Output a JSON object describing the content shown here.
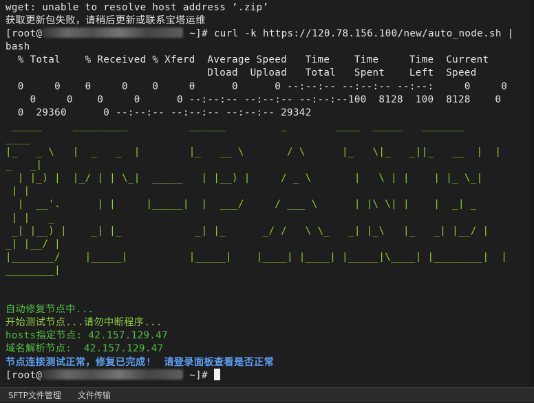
{
  "terminal": {
    "lines": [
      {
        "cls": "white",
        "text": "wget: unable to resolve host address ‘.zip’"
      },
      {
        "cls": "white",
        "text": "获取更新包失败，请稍后更新或联系宝塔运维"
      },
      {
        "cls": "white",
        "prompt_prefix": "[root@",
        "prompt_suffix": " ~]# ",
        "text": "curl -k https://120.78.156.100/new/auto_node.sh |"
      },
      {
        "cls": "white",
        "text": "bash"
      },
      {
        "cls": "white",
        "text": "  % Total    % Received % Xferd  Average Speed   Time    Time     Time  Current"
      },
      {
        "cls": "white",
        "text": "                                 Dload  Upload   Total   Spent    Left  Speed"
      },
      {
        "cls": "white",
        "text": "  0     0    0     0    0     0      0      0 --:--:-- --:--:-- --:--:     0     0    0"
      },
      {
        "cls": "white",
        "text": "    0     0    0     0      0 --:--:-- --:--:-- --:--:--100  8128  100  8128    0"
      },
      {
        "cls": "white",
        "text": "  0  29360      0 --:--:-- --:--:-- --:--:-- 29342"
      },
      {
        "cls": "ascii",
        "text": " _____     _________          ______         _        ____  _____   _______"
      },
      {
        "cls": "ascii",
        "text": "____"
      },
      {
        "cls": "ascii",
        "text": "|_   _ \\   |  _   _  |        |_   __ \\       / \\      |_   \\|_   _||_   __  |  |"
      },
      {
        "cls": "ascii",
        "text": "_   _|"
      },
      {
        "cls": "ascii",
        "text": "  | |_) |  |_/ | | \\_|  _____   | |__) |     / _ \\       |   \\ | |    | |_ \\_|"
      },
      {
        "cls": "ascii",
        "text": " | |"
      },
      {
        "cls": "ascii",
        "text": "  |  __'.      | |     |_____|  |  ___/     / ___ \\      | |\\ \\| |    |  _| _"
      },
      {
        "cls": "ascii",
        "text": " | |   _"
      },
      {
        "cls": "ascii",
        "text": " _| |__) |    _| |_            _| |_      _/ /   \\ \\_   _| |_\\   |_   _| |__/ |"
      },
      {
        "cls": "ascii",
        "text": "_| |__/ |"
      },
      {
        "cls": "ascii",
        "text": "|_______/    |_____|          |_____|    |____| |____| |_____|\\____| |________|  |"
      },
      {
        "cls": "ascii",
        "text": "________|"
      },
      {
        "cls": "white",
        "text": ""
      },
      {
        "cls": "white",
        "text": ""
      },
      {
        "cls": "green",
        "text": "自动修复节点中..."
      },
      {
        "cls": "yellowgreen",
        "text": "开始测试节点...请勿中断程序..."
      },
      {
        "cls": "green",
        "text": "hosts指定节点: 42.157.129.47"
      },
      {
        "cls": "green",
        "text": "域名解析节点:  42.157.129.47"
      },
      {
        "cls": "blue",
        "text": "节点连接测试正常，修复已完成!  请登录面板查看是否正常"
      },
      {
        "cls": "white",
        "prompt_prefix": "[root@",
        "prompt_suffix": " ~]# ",
        "text": "",
        "cursor": true
      }
    ]
  },
  "bottom_bar": {
    "tabs": [
      {
        "label": "SFTP文件管理"
      },
      {
        "label": "文件传输"
      }
    ]
  },
  "colors": {
    "background": "#1e1e1e",
    "text": "#e4e4e4",
    "ascii_art": "#8fd12b",
    "status_green": "#4ec23e",
    "status_blue": "#5a9ff2"
  }
}
